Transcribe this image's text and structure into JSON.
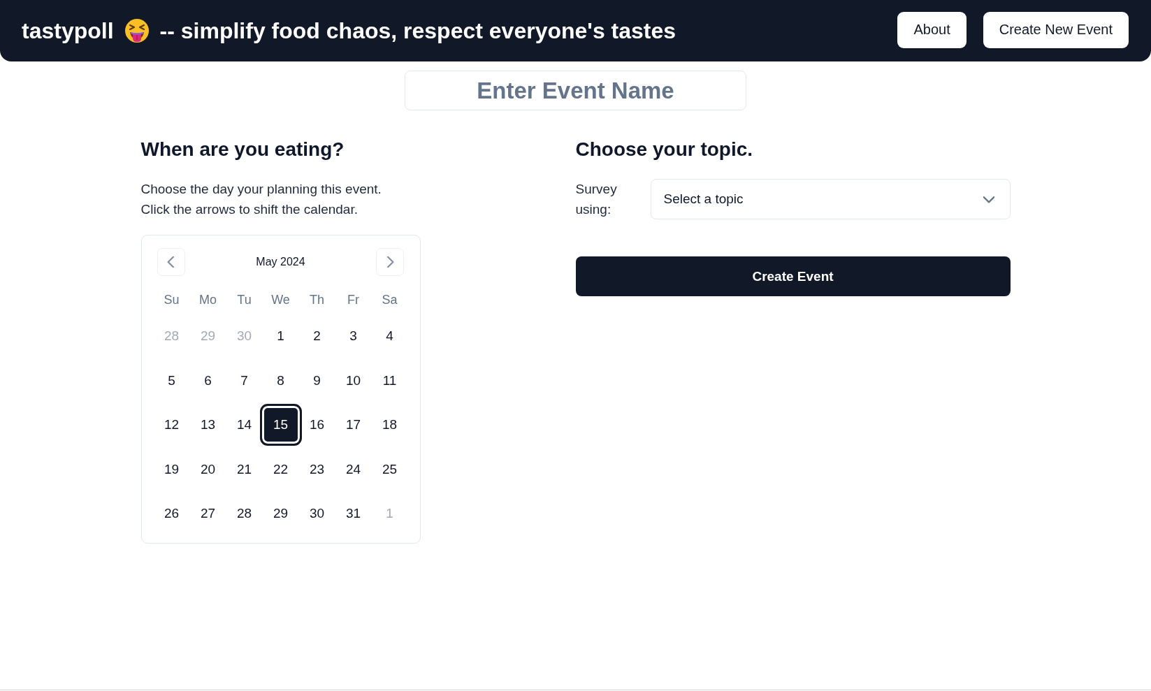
{
  "header": {
    "brand": "tastypoll",
    "tagline": "-- simplify food chaos, respect everyone's tastes",
    "buttons": [
      {
        "label": "About"
      },
      {
        "label": "Create New Event"
      }
    ]
  },
  "event_name": {
    "placeholder": "Enter Event Name"
  },
  "date_section": {
    "heading": "When are you eating?",
    "instructions": [
      "Choose the day your planning this event.",
      "Click the arrows to shift the calendar."
    ],
    "calendar": {
      "month": "May 2024",
      "weekdays": [
        "Su",
        "Mo",
        "Tu",
        "We",
        "Th",
        "Fr",
        "Sa"
      ],
      "weeks": [
        [
          {
            "label": "28",
            "outside": true,
            "selected": false
          },
          {
            "label": "29",
            "outside": true,
            "selected": false
          },
          {
            "label": "30",
            "outside": true,
            "selected": false
          },
          {
            "label": "1",
            "outside": false,
            "selected": false
          },
          {
            "label": "2",
            "outside": false,
            "selected": false
          },
          {
            "label": "3",
            "outside": false,
            "selected": false
          },
          {
            "label": "4",
            "outside": false,
            "selected": false
          }
        ],
        [
          {
            "label": "5",
            "outside": false,
            "selected": false
          },
          {
            "label": "6",
            "outside": false,
            "selected": false
          },
          {
            "label": "7",
            "outside": false,
            "selected": false
          },
          {
            "label": "8",
            "outside": false,
            "selected": false
          },
          {
            "label": "9",
            "outside": false,
            "selected": false
          },
          {
            "label": "10",
            "outside": false,
            "selected": false
          },
          {
            "label": "11",
            "outside": false,
            "selected": false
          }
        ],
        [
          {
            "label": "12",
            "outside": false,
            "selected": false
          },
          {
            "label": "13",
            "outside": false,
            "selected": false
          },
          {
            "label": "14",
            "outside": false,
            "selected": false
          },
          {
            "label": "15",
            "outside": false,
            "selected": true
          },
          {
            "label": "16",
            "outside": false,
            "selected": false
          },
          {
            "label": "17",
            "outside": false,
            "selected": false
          },
          {
            "label": "18",
            "outside": false,
            "selected": false
          }
        ],
        [
          {
            "label": "19",
            "outside": false,
            "selected": false
          },
          {
            "label": "20",
            "outside": false,
            "selected": false
          },
          {
            "label": "21",
            "outside": false,
            "selected": false
          },
          {
            "label": "22",
            "outside": false,
            "selected": false
          },
          {
            "label": "23",
            "outside": false,
            "selected": false
          },
          {
            "label": "24",
            "outside": false,
            "selected": false
          },
          {
            "label": "25",
            "outside": false,
            "selected": false
          }
        ],
        [
          {
            "label": "26",
            "outside": false,
            "selected": false
          },
          {
            "label": "27",
            "outside": false,
            "selected": false
          },
          {
            "label": "28",
            "outside": false,
            "selected": false
          },
          {
            "label": "29",
            "outside": false,
            "selected": false
          },
          {
            "label": "30",
            "outside": false,
            "selected": false
          },
          {
            "label": "31",
            "outside": false,
            "selected": false
          },
          {
            "label": "1",
            "outside": true,
            "selected": false
          }
        ]
      ]
    }
  },
  "topic_section": {
    "heading": "Choose your topic.",
    "field_label": "Survey using:",
    "select": {
      "placeholder": "Select a topic"
    },
    "submit": {
      "label": "Create Event"
    }
  }
}
